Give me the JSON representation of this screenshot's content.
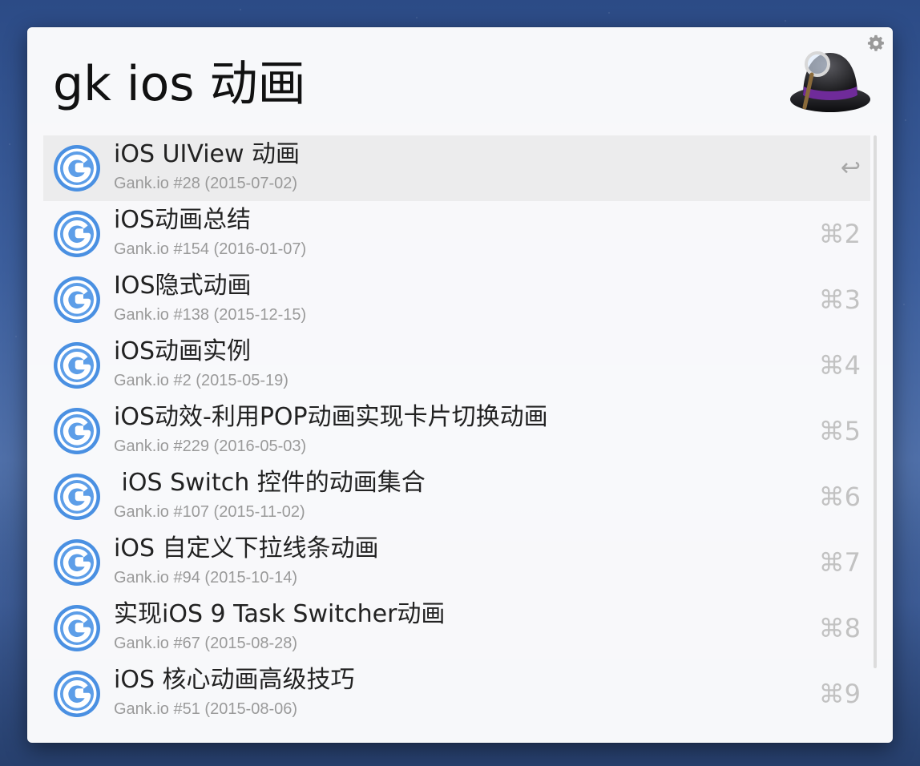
{
  "search": {
    "query": "gk ios 动画"
  },
  "icons": {
    "settings": "gear-icon",
    "app_logo": "alfred-hat-icon",
    "result_icon": "gank-g-icon",
    "return_key": "return-icon"
  },
  "colors": {
    "g_icon_blue": "#4a90e2",
    "selected_row": "#ececed"
  },
  "results": [
    {
      "title": "iOS UIView 动画",
      "subtitle": "Gank.io #28 (2015-07-02)",
      "shortcut": "↩",
      "selected": true
    },
    {
      "title": "iOS动画总结",
      "subtitle": "Gank.io #154 (2016-01-07)",
      "shortcut": "⌘2"
    },
    {
      "title": "IOS隐式动画",
      "subtitle": "Gank.io #138 (2015-12-15)",
      "shortcut": "⌘3"
    },
    {
      "title": "iOS动画实例",
      "subtitle": "Gank.io #2 (2015-05-19)",
      "shortcut": "⌘4"
    },
    {
      "title": "iOS动效-利用POP动画实现卡片切换动画",
      "subtitle": "Gank.io #229 (2016-05-03)",
      "shortcut": "⌘5"
    },
    {
      "title": " iOS Switch 控件的动画集合",
      "subtitle": "Gank.io #107 (2015-11-02)",
      "shortcut": "⌘6"
    },
    {
      "title": "iOS 自定义下拉线条动画",
      "subtitle": "Gank.io #94 (2015-10-14)",
      "shortcut": "⌘7"
    },
    {
      "title": "实现iOS 9 Task Switcher动画",
      "subtitle": "Gank.io #67 (2015-08-28)",
      "shortcut": "⌘8"
    },
    {
      "title": "iOS 核心动画高级技巧",
      "subtitle": "Gank.io #51 (2015-08-06)",
      "shortcut": "⌘9"
    }
  ]
}
